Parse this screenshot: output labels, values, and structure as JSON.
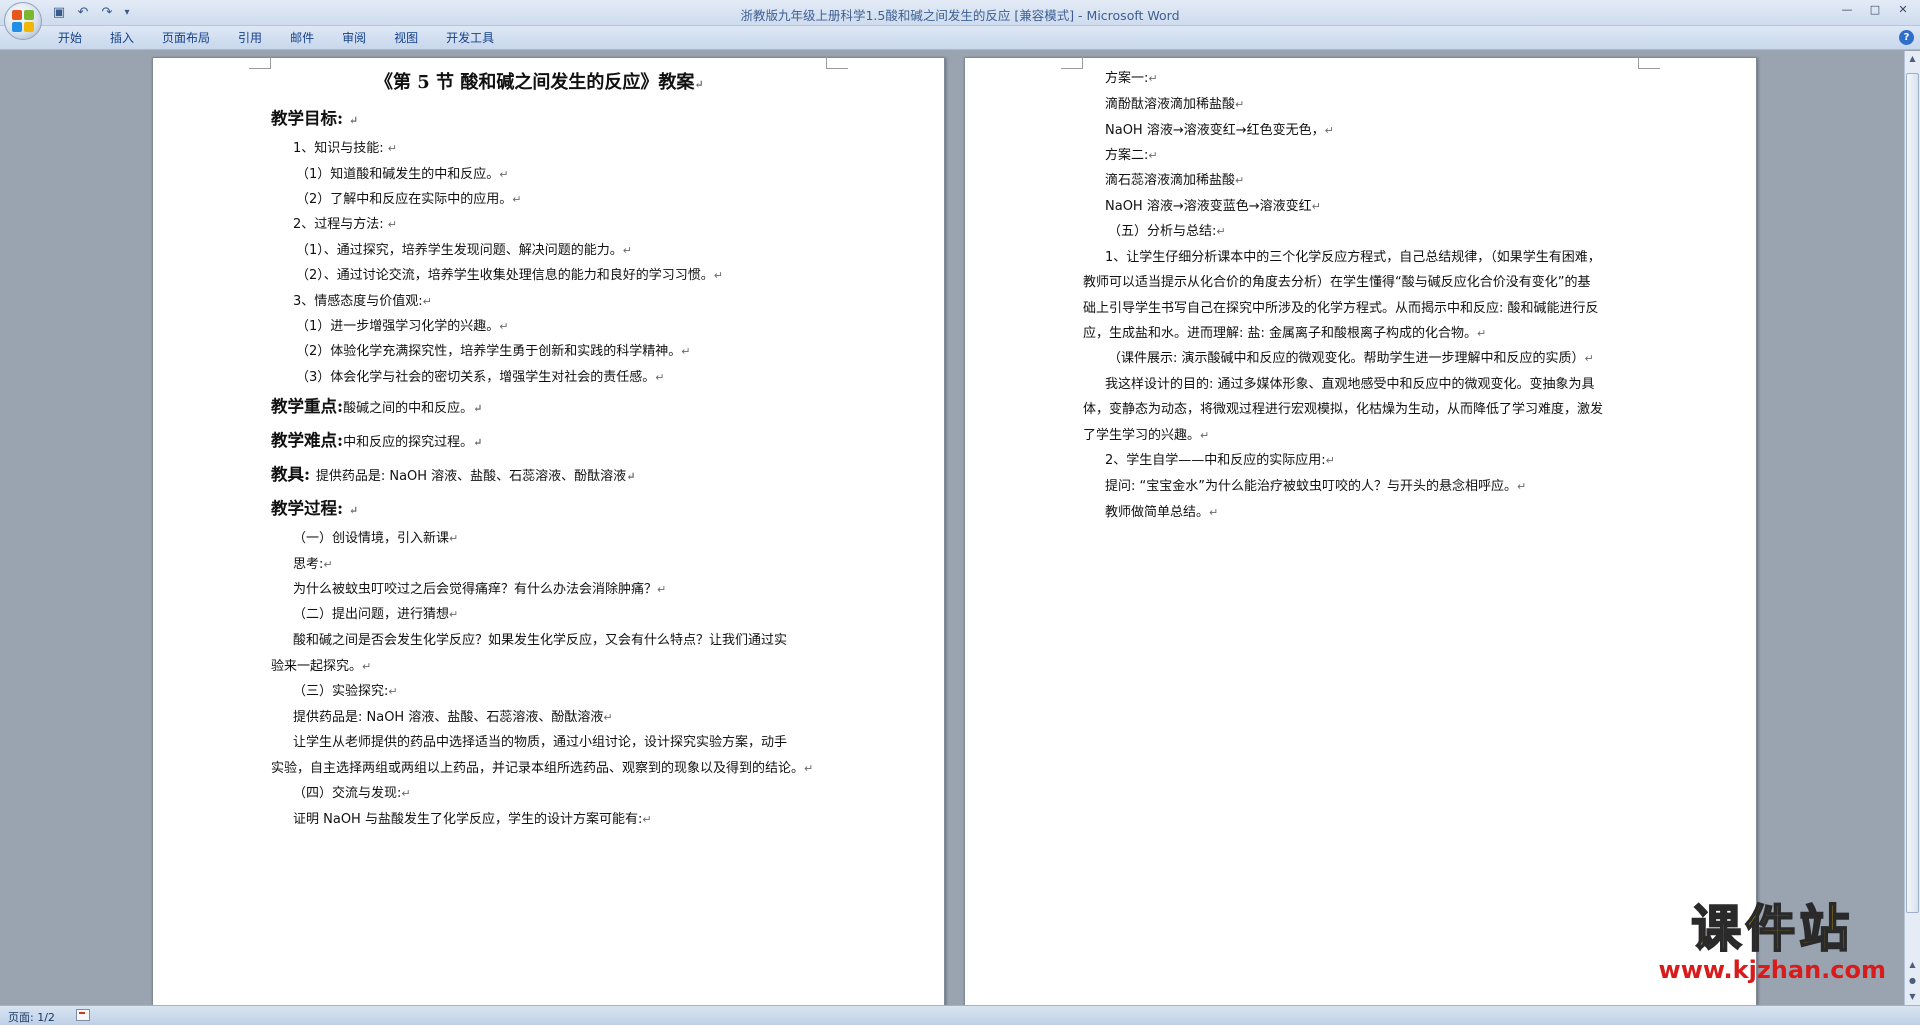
{
  "window": {
    "title": "浙教版九年级上册科学1.5酸和碱之间发生的反应 [兼容模式] - Microsoft Word"
  },
  "quick_access": [
    {
      "icon": "save-icon",
      "glyph": "▣"
    },
    {
      "icon": "undo-icon",
      "glyph": "↶"
    },
    {
      "icon": "redo-icon",
      "glyph": "↷"
    },
    {
      "icon": "customize-icon",
      "glyph": "▾"
    }
  ],
  "window_controls": [
    {
      "icon": "minimize-icon",
      "glyph": "—"
    },
    {
      "icon": "maximize-icon",
      "glyph": "□"
    },
    {
      "icon": "close-icon",
      "glyph": "✕"
    }
  ],
  "ribbon": {
    "tabs": [
      "开始",
      "插入",
      "页面布局",
      "引用",
      "邮件",
      "审阅",
      "视图",
      "开发工具"
    ],
    "help_glyph": "?"
  },
  "page1": {
    "title": "《第 5 节  酸和碱之间发生的反应》教案",
    "objectives_heading": "教学目标:",
    "lines": [
      "1、知识与技能:",
      "（1）知道酸和碱发生的中和反应。",
      "（2）了解中和反应在实际中的应用。",
      "2、过程与方法:",
      "（1）、通过探究，培养学生发现问题、解决问题的能力。",
      "（2）、通过讨论交流，培养学生收集处理信息的能力和良好的学习习惯。",
      "3、情感态度与价值观:",
      "（1）进一步增强学习化学的兴趣。",
      "（2）体验化学充满探究性，培养学生勇于创新和实践的科学精神。",
      "（3）体会化学与社会的密切关系，增强学生对社会的责任感。"
    ],
    "key_point_label": "教学重点:",
    "key_point_text": "酸碱之间的中和反应。",
    "difficulty_label": "教学难点:",
    "difficulty_text": "中和反应的探究过程。",
    "tools_label": "教具:",
    "tools_text": "提供药品是: NaOH 溶液、盐酸、石蕊溶液、酚酞溶液",
    "process_heading": "教学过程:",
    "process_lines": [
      "（一）创设情境，引入新课",
      "思考:",
      "为什么被蚊虫叮咬过之后会觉得痛痒？有什么办法会消除肿痛？",
      "（二）提出问题，进行猜想",
      "酸和碱之间是否会发生化学反应？如果发生化学反应，又会有什么特点？让我们通过实",
      "验来一起探究。",
      "（三）实验探究:",
      "提供药品是: NaOH 溶液、盐酸、石蕊溶液、酚酞溶液",
      "让学生从老师提供的药品中选择适当的物质，通过小组讨论，设计探究实验方案，动手",
      "实验，自主选择两组或两组以上药品，并记录本组所选药品、观察到的现象以及得到的结论。",
      "（四）交流与发现:",
      "证明 NaOH 与盐酸发生了化学反应，学生的设计方案可能有:"
    ]
  },
  "page2": {
    "lines": [
      "方案一:",
      "滴酚酞溶液滴加稀盐酸",
      "NaOH 溶液→溶液变红→红色变无色，",
      "方案二:",
      "滴石蕊溶液滴加稀盐酸",
      "NaOH 溶液→溶液变蓝色→溶液变红",
      "（五）分析与总结:",
      "1、让学生仔细分析课本中的三个化学反应方程式，自己总结规律，（如果学生有困难，",
      "教师可以适当提示从化合价的角度去分析）在学生懂得“酸与碱反应化合价没有变化”的基",
      "础上引导学生书写自己在探究中所涉及的化学方程式。从而揭示中和反应: 酸和碱能进行反",
      "应，生成盐和水。进而理解: 盐: 金属离子和酸根离子构成的化合物。",
      "（课件展示: 演示酸碱中和反应的微观变化。帮助学生进一步理解中和反应的实质）",
      "我这样设计的目的: 通过多媒体形象、直观地感受中和反应中的微观变化。变抽象为具",
      "体，变静态为动态，将微观过程进行宏观模拟，化枯燥为生动，从而降低了学习难度，激发",
      "了学生学习的兴趣。",
      "2、学生自学——中和反应的实际应用:",
      "提问: “宝宝金水”为什么能治疗被蚊虫叮咬的人？与开头的悬念相呼应。",
      "教师做简单总结。"
    ]
  },
  "statusbar": {
    "page_info": "页面: 1/2"
  },
  "watermark": {
    "main": "课件站",
    "url": "www.kjzhan.com"
  },
  "colors": {
    "brand_blue": "#15428b",
    "watermark_yellow": "#f5c400",
    "watermark_red": "#d81b1b"
  }
}
